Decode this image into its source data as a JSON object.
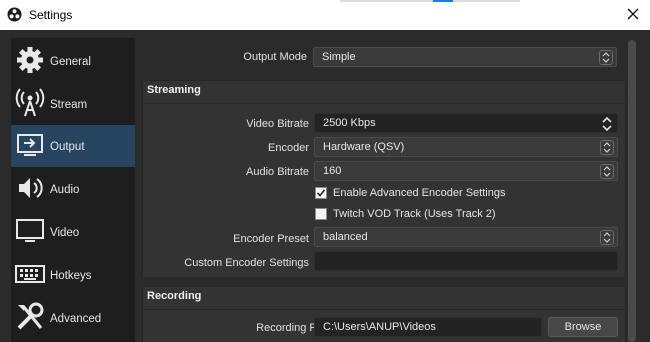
{
  "window": {
    "title": "Settings"
  },
  "sidebar": {
    "items": [
      {
        "label": "General",
        "icon": "gear-icon"
      },
      {
        "label": "Stream",
        "icon": "broadcast-icon"
      },
      {
        "label": "Output",
        "icon": "output-icon",
        "active": true
      },
      {
        "label": "Audio",
        "icon": "speaker-icon"
      },
      {
        "label": "Video",
        "icon": "monitor-icon"
      },
      {
        "label": "Hotkeys",
        "icon": "keyboard-icon"
      },
      {
        "label": "Advanced",
        "icon": "tools-icon"
      }
    ]
  },
  "main": {
    "output_mode": {
      "label": "Output Mode",
      "value": "Simple"
    },
    "streaming": {
      "title": "Streaming",
      "video_bitrate": {
        "label": "Video Bitrate",
        "value": "2500 Kbps"
      },
      "encoder": {
        "label": "Encoder",
        "value": "Hardware (QSV)"
      },
      "audio_bitrate": {
        "label": "Audio Bitrate",
        "value": "160"
      },
      "enable_advanced": {
        "label": "Enable Advanced Encoder Settings",
        "checked": true
      },
      "twitch_vod": {
        "label": "Twitch VOD Track (Uses Track 2)",
        "checked": false
      },
      "encoder_preset": {
        "label": "Encoder Preset",
        "value": "balanced"
      },
      "custom_settings": {
        "label": "Custom Encoder Settings",
        "value": ""
      }
    },
    "recording": {
      "title": "Recording",
      "path": {
        "label": "Recording Path",
        "value": "C:\\Users\\ANUP\\Videos"
      },
      "browse_label": "Browse"
    }
  },
  "colors": {
    "background": "#2b2b2b",
    "sidebar": "#1e1e1e",
    "active_item": "#274560",
    "group": "#333333",
    "accent": "#1e7bd9"
  }
}
